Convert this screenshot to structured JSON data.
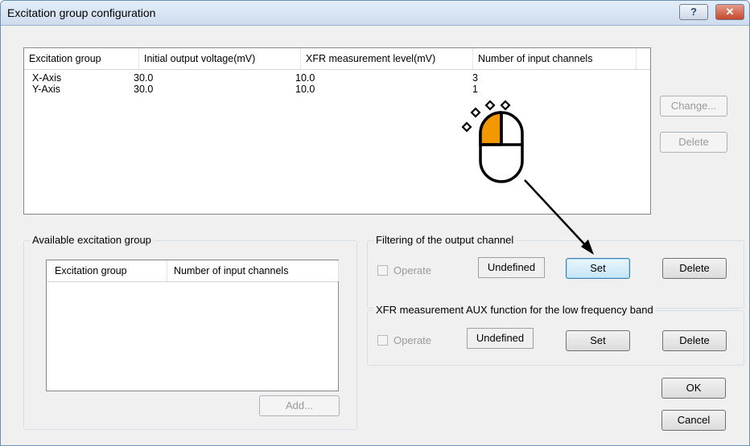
{
  "window": {
    "title": "Excitation group configuration",
    "help_glyph": "?",
    "close_glyph": "✕"
  },
  "groups_list": {
    "columns": [
      "Excitation group",
      "Initial output voltage(mV)",
      "XFR measurement level(mV)",
      "Number of input channels"
    ],
    "rows": [
      [
        "X-Axis",
        "30.0",
        "10.0",
        "3"
      ],
      [
        "Y-Axis",
        "30.0",
        "10.0",
        "1"
      ]
    ]
  },
  "side_buttons": {
    "change": "Change...",
    "delete": "Delete"
  },
  "available": {
    "label": "Available excitation group",
    "columns": [
      "Excitation group",
      "Number of input channels"
    ],
    "add_label": "Add..."
  },
  "filtering": {
    "label": "Filtering of the output channel",
    "operate_label": "Operate",
    "status": "Undefined",
    "set_label": "Set",
    "delete_label": "Delete"
  },
  "aux": {
    "label": "XFR measurement AUX function for the low frequency band",
    "operate_label": "Operate",
    "status": "Undefined",
    "set_label": "Set",
    "delete_label": "Delete"
  },
  "footer": {
    "ok_label": "OK",
    "cancel_label": "Cancel"
  },
  "colors": {
    "mouse_highlight": "#f39800",
    "arrow": "#000000"
  },
  "icons": {
    "mouse": "mouse-click-icon",
    "arrow": "arrow-icon"
  }
}
